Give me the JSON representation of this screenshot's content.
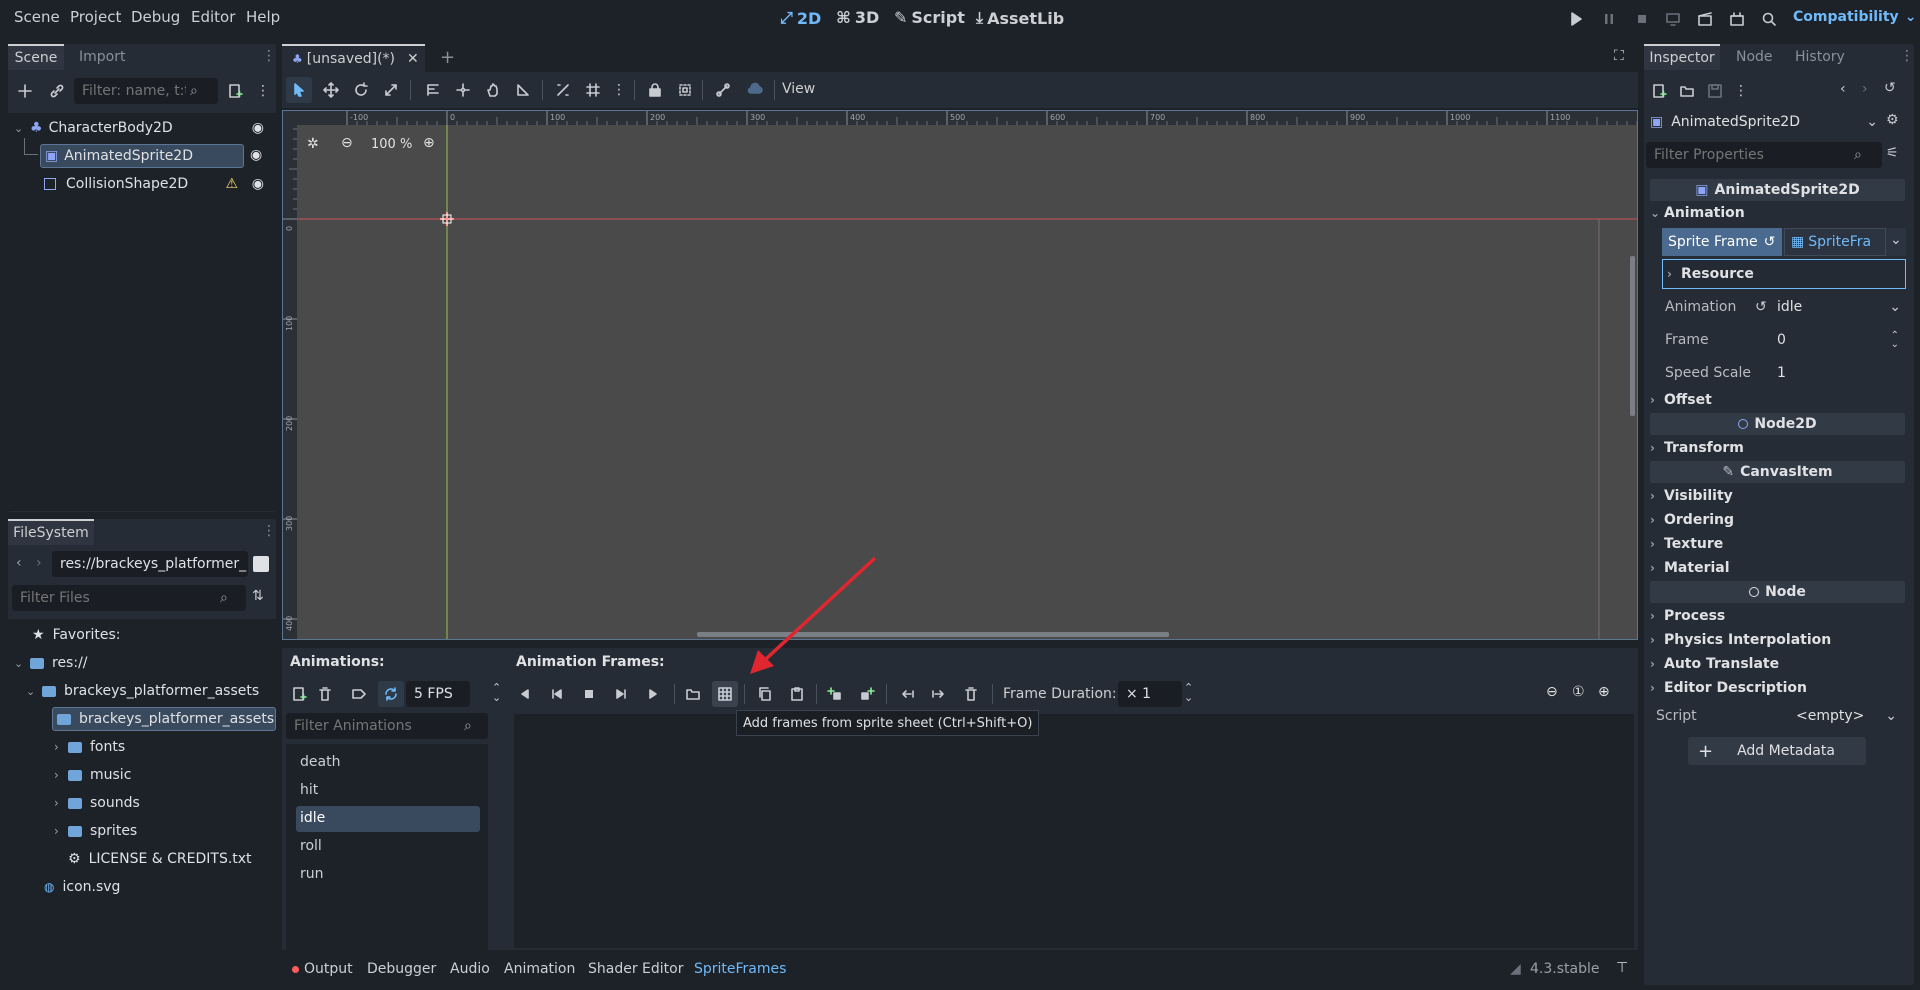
{
  "menu": [
    "Scene",
    "Project",
    "Debug",
    "Editor",
    "Help"
  ],
  "modes": [
    {
      "label": "2D",
      "active": true
    },
    {
      "label": "3D",
      "active": false
    },
    {
      "label": "Script",
      "active": false
    },
    {
      "label": "AssetLib",
      "active": false
    }
  ],
  "renderer": "Compatibility",
  "scene_dock": {
    "tabs": [
      "Scene",
      "Import"
    ],
    "filter_placeholder": "Filter: name, t:t",
    "nodes": [
      {
        "name": "CharacterBody2D",
        "selected": false
      },
      {
        "name": "AnimatedSprite2D",
        "selected": true
      },
      {
        "name": "CollisionShape2D",
        "selected": false
      }
    ]
  },
  "filesystem": {
    "tab": "FileSystem",
    "path": "res://brackeys_platformer_",
    "filter_placeholder": "Filter Files",
    "items": [
      "Favorites:",
      "res://",
      "brackeys_platformer_assets",
      "brackeys_platformer_assets",
      "fonts",
      "music",
      "sounds",
      "sprites",
      "LICENSE & CREDITS.txt",
      "icon.svg"
    ]
  },
  "editor_tab": "[unsaved](*)",
  "toolbar": {
    "view_label": "View"
  },
  "canvas": {
    "zoom": "100 %",
    "ruler_x": [
      "-100",
      "0",
      "100",
      "200",
      "300",
      "400",
      "500",
      "600",
      "700",
      "800",
      "900",
      "1000",
      "1100"
    ],
    "ruler_y": [
      "0",
      "100",
      "200",
      "300",
      "400"
    ]
  },
  "spriteframes": {
    "animations_label": "Animations:",
    "frames_label": "Animation Frames:",
    "fps": "5 FPS",
    "frame_duration_label": "Frame Duration:",
    "frame_duration": "× 1",
    "filter_placeholder": "Filter Animations",
    "animations": [
      "death",
      "hit",
      "idle",
      "roll",
      "run"
    ],
    "selected_animation": "idle",
    "tooltip": "Add frames from sprite sheet (Ctrl+Shift+O)"
  },
  "bottom_tabs": [
    "Output",
    "Debugger",
    "Audio",
    "Animation",
    "Shader Editor",
    "SpriteFrames"
  ],
  "version": "4.3.stable",
  "inspector": {
    "tabs": [
      "Inspector",
      "Node",
      "History"
    ],
    "node_name": "AnimatedSprite2D",
    "filter_placeholder": "Filter Properties",
    "class_header": "AnimatedSprite2D",
    "animation_section": "Animation",
    "sprite_frames_label": "Sprite Frame",
    "sprite_frames_value": "SpriteFra",
    "resource_label": "Resource",
    "animation_label": "Animation",
    "animation_value": "idle",
    "frame_label": "Frame",
    "frame_value": "0",
    "speed_label": "Speed Scale",
    "speed_value": "1",
    "offset_section": "Offset",
    "node2d_header": "Node2D",
    "transform_section": "Transform",
    "canvasitem_header": "CanvasItem",
    "canvasitem_sections": [
      "Visibility",
      "Ordering",
      "Texture",
      "Material"
    ],
    "node_header": "Node",
    "node_sections": [
      "Process",
      "Physics Interpolation",
      "Auto Translate",
      "Editor Description"
    ],
    "script_label": "Script",
    "script_value": "<empty>",
    "add_metadata": "Add Metadata"
  },
  "colors": {
    "accent": "#70bafa",
    "selection": "#3a4a5e",
    "bg": "#1d2229",
    "panel": "#262c35",
    "warning": "#ffdd65",
    "arrow": "#e0262e"
  }
}
